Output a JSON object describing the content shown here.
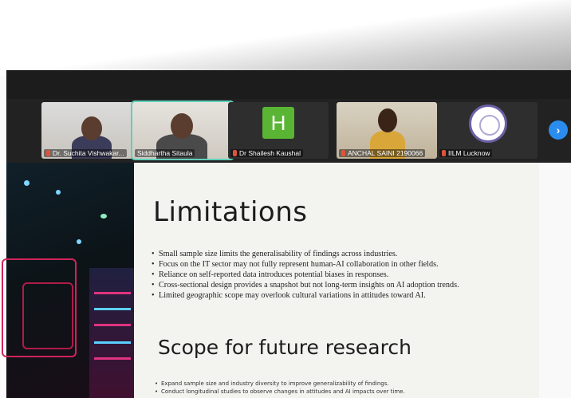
{
  "participants": [
    {
      "name": "Dr. Suchita Vishwakar...",
      "type": "camera"
    },
    {
      "name": "Siddhartha Sitaula",
      "type": "camera",
      "active": true
    },
    {
      "name": "Dr Shailesh Kaushal",
      "type": "avatar",
      "avatar_letter": "H"
    },
    {
      "name": "ANCHAL SAINI 2190066",
      "type": "camera"
    },
    {
      "name": "IILM Lucknow",
      "type": "logo"
    }
  ],
  "next_icon": "chevron-right-icon",
  "colors": {
    "active_border": "#5fd0b8",
    "avatar_bg": "#5ab535",
    "next_button": "#2b8cf0",
    "mic_muted": "#e0533b"
  },
  "slide": {
    "title": "Limitations",
    "bullets": [
      "Small sample size limits the generalisability of findings across industries.",
      "Focus on the IT sector may not fully represent human-AI collaboration in other fields.",
      "Reliance on self-reported data introduces potential biases in responses.",
      "Cross-sectional design provides a snapshot but not long-term insights on AI adoption trends.",
      "Limited geographic scope may overlook cultural variations in attitudes toward AI."
    ],
    "section_title": "Scope for future research",
    "future_bullets": [
      "Expand sample size and industry diversity to improve generalizability of findings.",
      "Conduct longitudinal studies to observe changes in attitudes and AI impacts over time."
    ]
  }
}
